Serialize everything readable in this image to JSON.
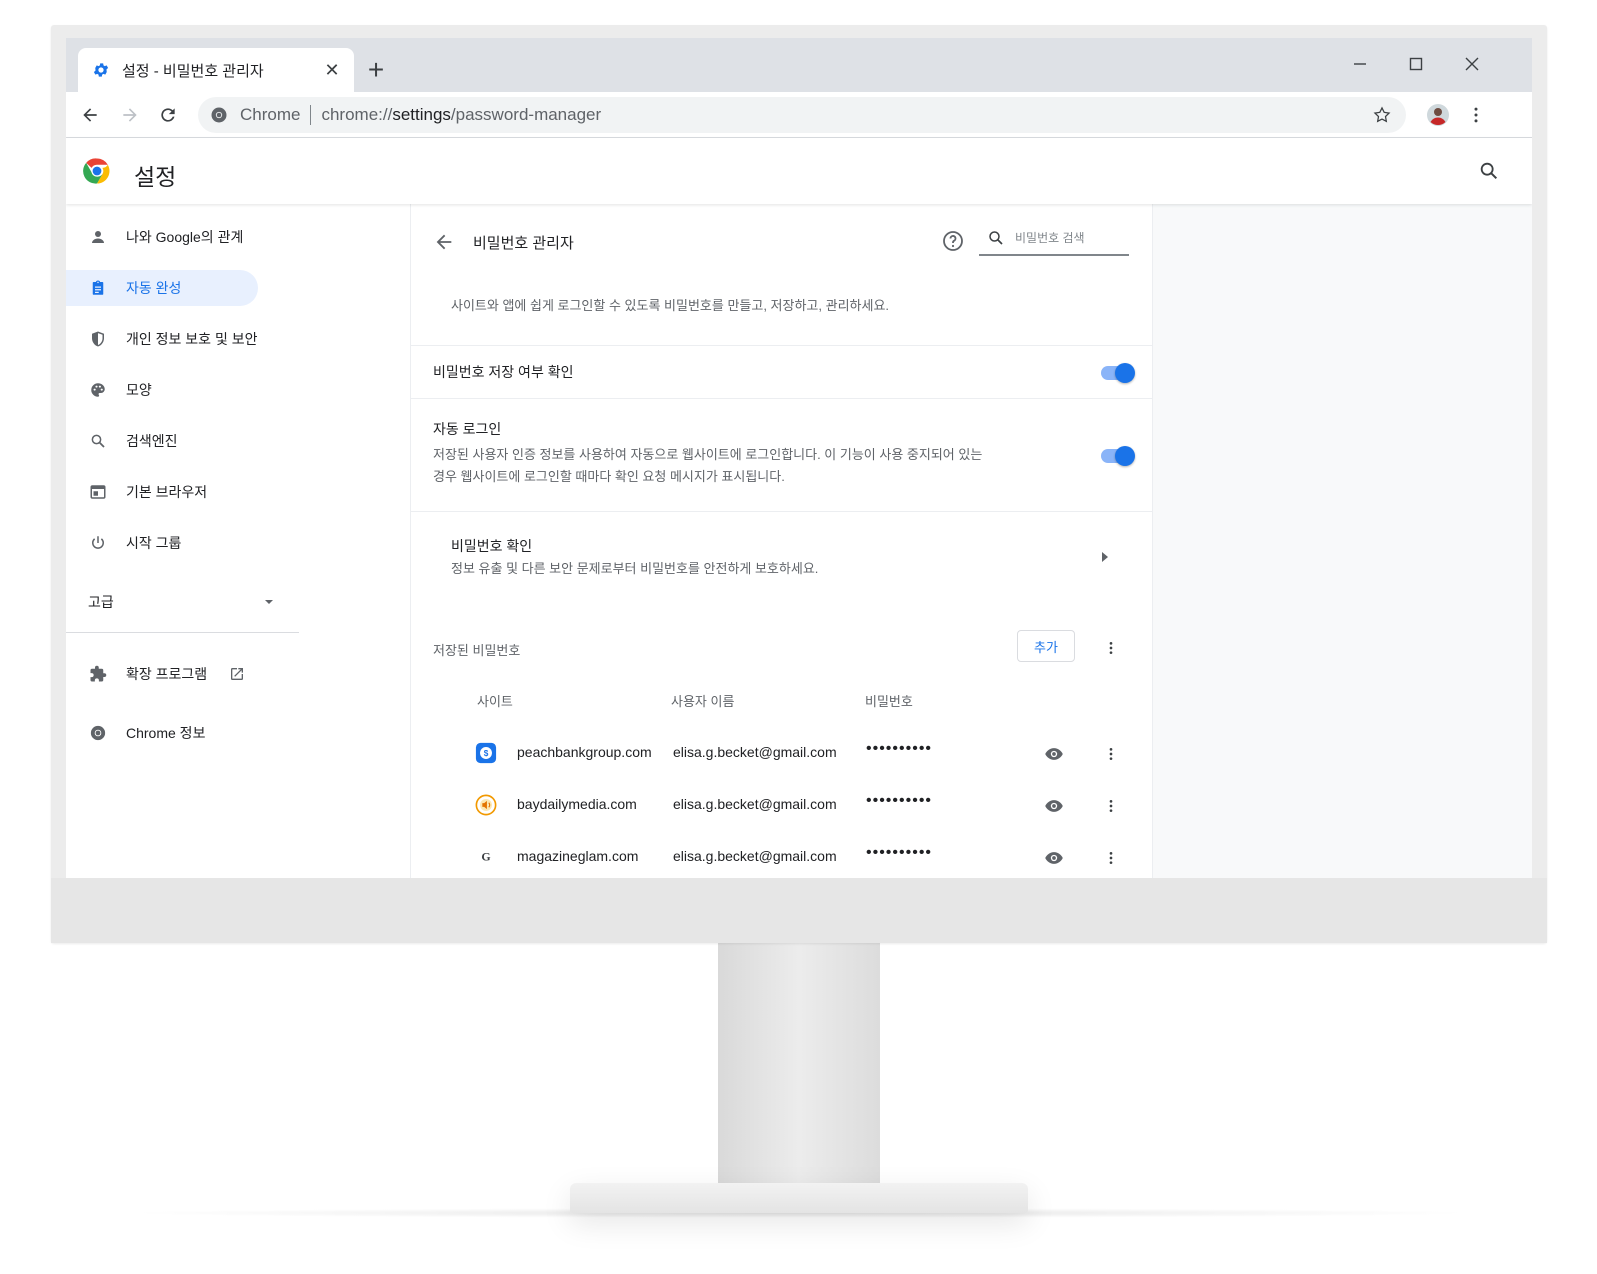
{
  "tab": {
    "title": "설정 - 비밀번호 관리자",
    "close": "✕",
    "new": "+"
  },
  "omnibox": {
    "chip": "Chrome",
    "url_prefix": "chrome://",
    "url_host": "settings",
    "url_path": "/password-manager"
  },
  "header": {
    "title": "설정"
  },
  "sidebar": {
    "items": [
      {
        "label": "나와 Google의 관계",
        "icon": "person-icon"
      },
      {
        "label": "자동 완성",
        "icon": "clipboard-icon",
        "active": true
      },
      {
        "label": "개인 정보 보호 및 보안",
        "icon": "shield-icon"
      },
      {
        "label": "모양",
        "icon": "palette-icon"
      },
      {
        "label": "검색엔진",
        "icon": "search-icon"
      },
      {
        "label": "기본 브라우저",
        "icon": "browser-window-icon"
      },
      {
        "label": "시작 그룹",
        "icon": "power-icon"
      }
    ],
    "advanced": "고급",
    "extensions": "확장 프로그램",
    "about": "Chrome 정보"
  },
  "main": {
    "title": "비밀번호 관리자",
    "search_placeholder": "비밀번호 검색",
    "description": "사이트와 앱에 쉽게 로그인할 수 있도록 비밀번호를 만들고, 저장하고, 관리하세요.",
    "offer_save": {
      "label": "비밀번호 저장 여부 확인",
      "enabled": true
    },
    "auto_signin": {
      "label": "자동 로그인",
      "line1": "저장된 사용자 인증 정보를 사용하여 자동으로 웹사이트에 로그인합니다. 이 기능이 사용 중지되어 있는",
      "line2": "경우 웹사이트에 로그인할 때마다 확인 요청 메시지가 표시됩니다.",
      "enabled": true
    },
    "check": {
      "label": "비밀번호 확인",
      "sub": "정보 유출 및 다른 보안 문제로부터 비밀번호를 안전하게 보호하세요."
    },
    "saved": {
      "label": "저장된 비밀번호",
      "add": "추가"
    },
    "columns": {
      "site": "사이트",
      "user": "사용자 이름",
      "password": "비밀번호"
    },
    "rows": [
      {
        "site": "peachbankgroup.com",
        "user": "elisa.g.becket@gmail.com",
        "password": "••••••••••",
        "color": "#1a73e8"
      },
      {
        "site": "baydailymedia.com",
        "user": "elisa.g.becket@gmail.com",
        "password": "••••••••••",
        "color": "#f29900"
      },
      {
        "site": "magazineglam.com",
        "user": "elisa.g.becket@gmail.com",
        "password": "••••••••••",
        "color": "#3c4043"
      }
    ]
  },
  "colors": {
    "accent": "#1a73e8",
    "accent_light": "#8ab4f8",
    "active_bg": "#e8f0fe"
  }
}
